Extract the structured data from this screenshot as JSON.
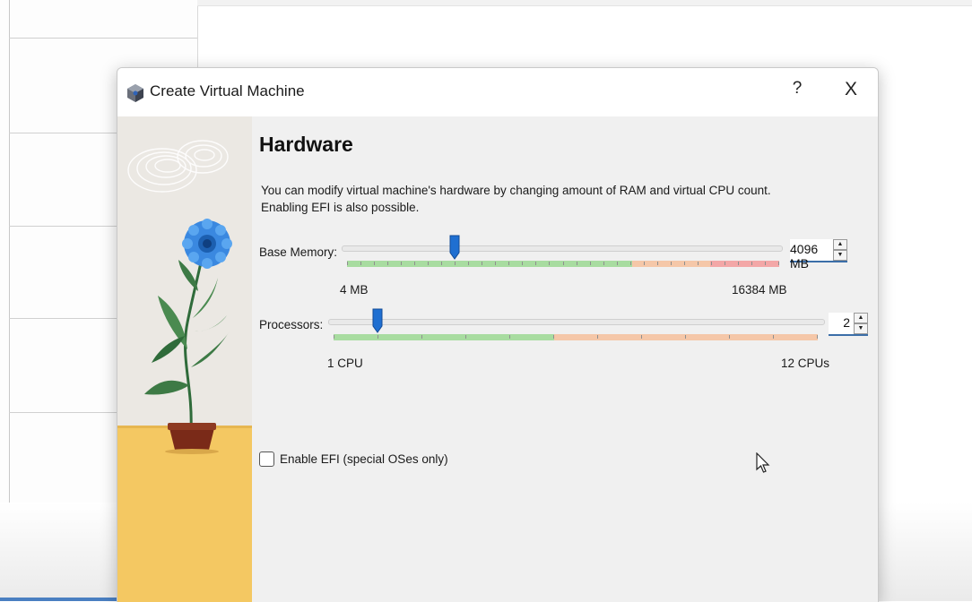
{
  "window": {
    "title": "Create Virtual Machine",
    "help_label": "?",
    "close_label": "X"
  },
  "page": {
    "heading": "Hardware",
    "description_line1": "You can modify virtual machine's hardware by changing amount of RAM and virtual CPU count.",
    "description_line2": "Enabling EFI is also possible."
  },
  "memory": {
    "label": "Base Memory:",
    "value": "4096 MB",
    "min_label": "4 MB",
    "max_label": "16384 MB",
    "level": 0.25
  },
  "processors": {
    "label": "Processors:",
    "value": "2",
    "min_label": "1 CPU",
    "max_label": "12 CPUs",
    "level": 0.09
  },
  "efi": {
    "label": "Enable EFI (special OSes only)",
    "checked": false
  },
  "icons": [
    "virtualbox-logo-icon",
    "help-icon",
    "close-icon",
    "spin-up-icon",
    "spin-down-icon",
    "mouse-cursor-icon"
  ],
  "colors": {
    "accent": "#1f6fd1",
    "zone_green": "#a8dca0",
    "zone_orange": "#f5c7a8",
    "zone_red": "#f3a7a7"
  }
}
